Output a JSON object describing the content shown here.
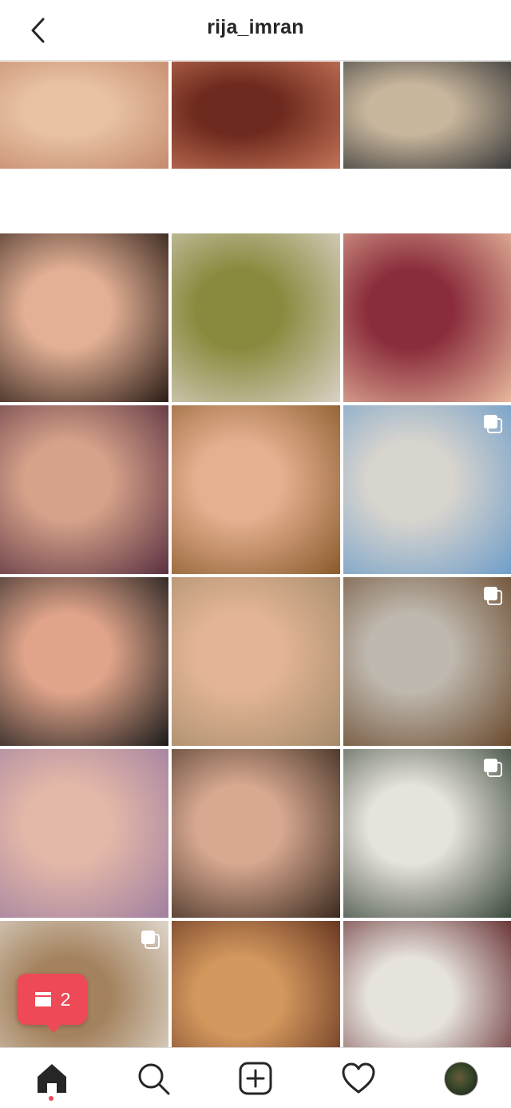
{
  "header": {
    "title": "rija_imran",
    "back_icon": "chevron-left-icon"
  },
  "grid": {
    "tiles": [
      {
        "subject": "eye-liner-closeup",
        "colors": [
          "#e9c2a4",
          "#c48a6c"
        ],
        "multi": false
      },
      {
        "subject": "red-hair-portrait",
        "colors": [
          "#6e2a1e",
          "#c47458"
        ],
        "multi": false
      },
      {
        "subject": "cafe-drink",
        "colors": [
          "#c9b79d",
          "#3a3a3a"
        ],
        "multi": false
      },
      {
        "subject": "graphic-liner-earring",
        "colors": [
          "#e3b095",
          "#2a1c16"
        ],
        "multi": false
      },
      {
        "subject": "olive-shirt-portrait",
        "colors": [
          "#8a8a3e",
          "#d9d2c6"
        ],
        "multi": false
      },
      {
        "subject": "burgundy-eye",
        "colors": [
          "#8a2c3c",
          "#e6b89c"
        ],
        "multi": false
      },
      {
        "subject": "wine-liner-face",
        "colors": [
          "#d6a28a",
          "#5a3040"
        ],
        "multi": false
      },
      {
        "subject": "teal-eye-beanie",
        "colors": [
          "#e4b090",
          "#8a5a2a"
        ],
        "multi": false
      },
      {
        "subject": "blue-top-chair",
        "colors": [
          "#d8d4ce",
          "#6f9ec9"
        ],
        "multi": true
      },
      {
        "subject": "mint-liner-face",
        "colors": [
          "#e0a48a",
          "#1a1a1a"
        ],
        "multi": false
      },
      {
        "subject": "bronze-eye-beanie",
        "colors": [
          "#e3b595",
          "#a48a6a"
        ],
        "multi": false
      },
      {
        "subject": "corduroy-jacket",
        "colors": [
          "#bfb8ae",
          "#6a4a2e"
        ],
        "multi": true
      },
      {
        "subject": "pink-eye-beanie",
        "colors": [
          "#e4b8a8",
          "#a07fa0"
        ],
        "multi": false
      },
      {
        "subject": "pink-liner-portrait",
        "colors": [
          "#d8a890",
          "#3a2a1e"
        ],
        "multi": false
      },
      {
        "subject": "plaid-shirt",
        "colors": [
          "#e6e2dc",
          "#3c4a3c"
        ],
        "multi": true
      },
      {
        "subject": "white-jacket-fence",
        "colors": [
          "#a4825e",
          "#e6e2da"
        ],
        "multi": true
      },
      {
        "subject": "tan-beanie-car",
        "colors": [
          "#d4985e",
          "#5a2a1a"
        ],
        "multi": false
      },
      {
        "subject": "red-dress-room",
        "colors": [
          "#e6e2dc",
          "#5a1e22"
        ],
        "multi": false
      }
    ]
  },
  "toast": {
    "count": "2",
    "icon": "posts-stack-icon"
  },
  "tabbar": {
    "home_icon": "home-icon",
    "search_icon": "search-icon",
    "new_post_icon": "plus-square-icon",
    "activity_icon": "heart-icon",
    "profile_icon": "avatar"
  }
}
